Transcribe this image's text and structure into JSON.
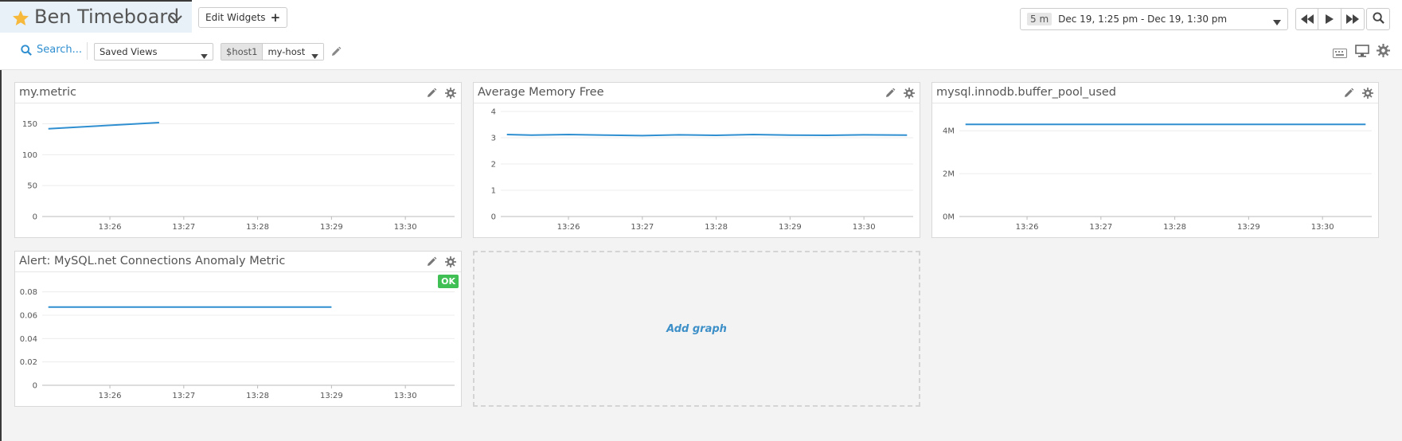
{
  "header": {
    "title": "Ben Timeboard",
    "edit_widgets_label": "Edit Widgets",
    "time_badge": "5 m",
    "time_range": "Dec 19, 1:25 pm - Dec 19, 1:30 pm"
  },
  "filters": {
    "search_label": "Search...",
    "saved_views": "Saved Views",
    "template_variable": {
      "name": "$host1",
      "value": "my-host"
    }
  },
  "colors": {
    "line": "#2f8fd0",
    "accent": "#2f8fd0",
    "ok": "#3fbf54",
    "star": "#f6b93b"
  },
  "icons": [
    "star-icon",
    "chevron-down-icon",
    "plus-icon",
    "caret-down-icon",
    "rewind-icon",
    "play-icon",
    "fast-forward-icon",
    "search-icon",
    "pencil-icon",
    "keyboard-icon",
    "monitor-icon",
    "gear-icon"
  ],
  "widgets": [
    {
      "title": "my.metric",
      "chart_data": {
        "type": "line",
        "x_ticks": [
          "13:26",
          "13:27",
          "13:28",
          "13:29",
          "13:30"
        ],
        "y_ticks": [
          "0",
          "50",
          "100",
          "150"
        ],
        "ylim": [
          0,
          170
        ],
        "series": [
          {
            "x": [
              "13:25:10",
              "13:26:40"
            ],
            "y": [
              142,
              152
            ]
          }
        ]
      }
    },
    {
      "title": "Average Memory Free",
      "chart_data": {
        "type": "line",
        "x_ticks": [
          "13:26",
          "13:27",
          "13:28",
          "13:29",
          "13:30"
        ],
        "y_ticks": [
          "0",
          "1",
          "2",
          "3",
          "4"
        ],
        "ylim": [
          0,
          4
        ],
        "series": [
          {
            "x": [
              "13:25:10",
              "13:25:30",
              "13:26:00",
              "13:26:30",
              "13:27:00",
              "13:27:30",
              "13:28:00",
              "13:28:30",
              "13:29:00",
              "13:29:30",
              "13:30:00",
              "13:30:35"
            ],
            "y": [
              3.12,
              3.1,
              3.12,
              3.1,
              3.08,
              3.11,
              3.09,
              3.12,
              3.1,
              3.09,
              3.11,
              3.1
            ]
          }
        ]
      }
    },
    {
      "title": "mysql.innodb.buffer_pool_used",
      "chart_data": {
        "type": "line",
        "x_ticks": [
          "13:26",
          "13:27",
          "13:28",
          "13:29",
          "13:30"
        ],
        "y_ticks": [
          "0M",
          "2M",
          "4M"
        ],
        "ylim": [
          0,
          4.9
        ],
        "series": [
          {
            "x": [
              "13:25:10",
              "13:30:35"
            ],
            "y": [
              4.3,
              4.3
            ]
          }
        ]
      }
    },
    {
      "title": "Alert: MySQL.net Connections Anomaly Metric",
      "badge": "OK",
      "chart_data": {
        "type": "line",
        "x_ticks": [
          "13:26",
          "13:27",
          "13:28",
          "13:29",
          "13:30"
        ],
        "y_ticks": [
          "0",
          "0.02",
          "0.04",
          "0.06",
          "0.08"
        ],
        "ylim": [
          0,
          0.09
        ],
        "series": [
          {
            "x": [
              "13:25:10",
              "13:29:00"
            ],
            "y": [
              0.067,
              0.067
            ]
          }
        ]
      }
    }
  ],
  "add_graph_label": "Add graph"
}
